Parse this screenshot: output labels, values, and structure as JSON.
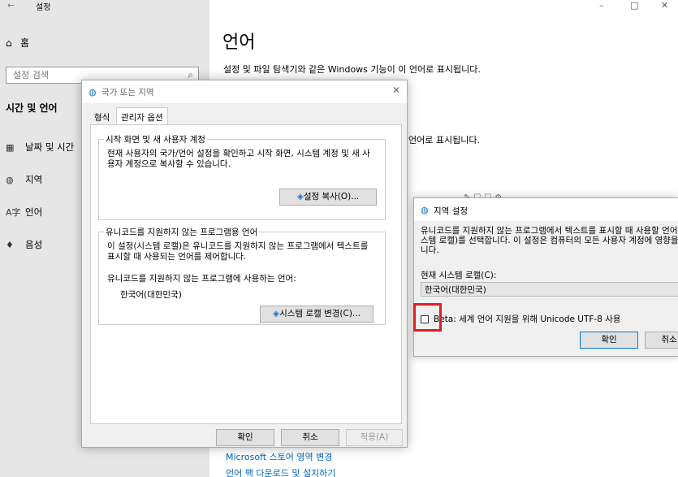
{
  "titlebar": {
    "back": "←",
    "title": "설정",
    "minimize": "–",
    "maximize": "□",
    "close": "✕"
  },
  "sidebar": {
    "home_label": "홈",
    "search_placeholder": "설정 검색",
    "section_title": "시간 및 언어",
    "items": [
      {
        "icon": "calendar-icon",
        "label": "날짜 및 시간"
      },
      {
        "icon": "globe-icon",
        "label": "지역"
      },
      {
        "icon": "language-icon",
        "label": "언어"
      },
      {
        "icon": "microphone-icon",
        "label": "음성"
      }
    ]
  },
  "main": {
    "title": "언어",
    "description": "설정 및 파일 탐색기와 같은 Windows 기능이 이 언어로 표시됩니다.",
    "description2": "언어로 표시됩니다.",
    "links": [
      "Microsoft 스토어 영역 변경",
      "언어 팩 다운로드 및 설치하기"
    ]
  },
  "region_dialog": {
    "title": "국가 또는 지역",
    "tabs": [
      "형식",
      "관리자 옵션"
    ],
    "group1": {
      "label": "시작 화면 및 새 사용자 계정",
      "text": "현재 사용자의 국가/언어 설정을 확인하고 시작 화면, 시스템 계정 및 새 사용자 계정으로 복사할 수 있습니다.",
      "button": "설정 복사(O)..."
    },
    "group2": {
      "label": "유니코드를 지원하지 않는 프로그램용 언어",
      "text": "이 설정(시스템 로캘)은 유니코드를 지원하지 않는 프로그램에서 텍스트를 표시할 때 사용되는 언어를 제어합니다.",
      "current_label": "유니코드를 지원하지 않는 프로그램에 사용하는 언어:",
      "current_value": "한국어(대한민국)",
      "button": "시스템 로캘 변경(C)..."
    },
    "ok": "확인",
    "cancel": "취소",
    "apply": "적용(A)"
  },
  "locale_dialog": {
    "title": "지역 설정",
    "description_lines": [
      "유니코드를 지원하지 않는 프로그램에서 텍스트를 표시할 때 사용할 언어",
      "스템 로캘)를 선택합니다. 이 설정은 컴퓨터의 모든 사용자 계정에 영향을",
      "니다."
    ],
    "current_label": "현재 시스템 로캘(C):",
    "current_value": "한국어(대한민국)",
    "beta_checkbox_label": "Beta: 세계 언어 지원을 위해 Unicode UTF-8 사용",
    "beta_checked": false,
    "ok": "확인",
    "cancel": "취소"
  },
  "colors": {
    "highlight": "#e51c23",
    "link": "#0067c0",
    "sidebar_bg": "#e6e6e6"
  }
}
